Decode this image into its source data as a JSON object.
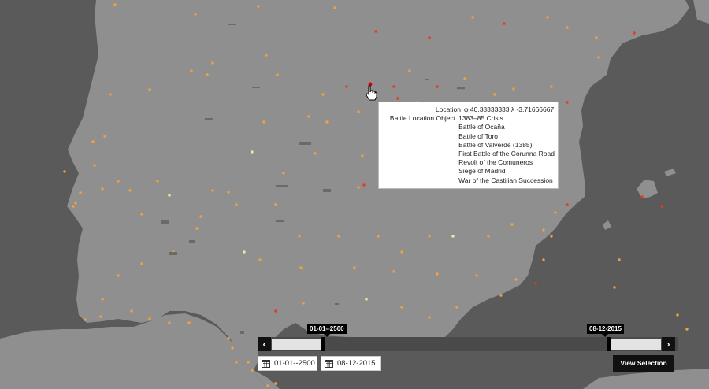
{
  "tooltip": {
    "location_label": "Location",
    "location_value": "φ 40.38333333 λ -3.71666667",
    "object_label": "Battle Location Object",
    "battles": [
      "1383–85 Crisis",
      "Battle of Ocaña",
      "Battle of Toro",
      "Battle of Valverde (1385)",
      "First Battle of the Corunna Road",
      "Revolt of the Comuneros",
      "Siege of Madrid",
      "War of the Castilian Succession"
    ]
  },
  "timeline": {
    "start_label": "01-01--2500",
    "end_label": "08-12-2015",
    "start_field": "01-01--2500",
    "end_field": "08-12-2015",
    "prev_icon": "chevron-left-icon",
    "next_icon": "chevron-right-icon",
    "view_selection_label": "View Selection"
  },
  "colors": {
    "sea": "#5a5a5a",
    "land": "#8f8f8f",
    "dot_orange": "#f0a040",
    "dot_red": "#e53b1e",
    "dot_pale": "#f6e3a0"
  }
}
